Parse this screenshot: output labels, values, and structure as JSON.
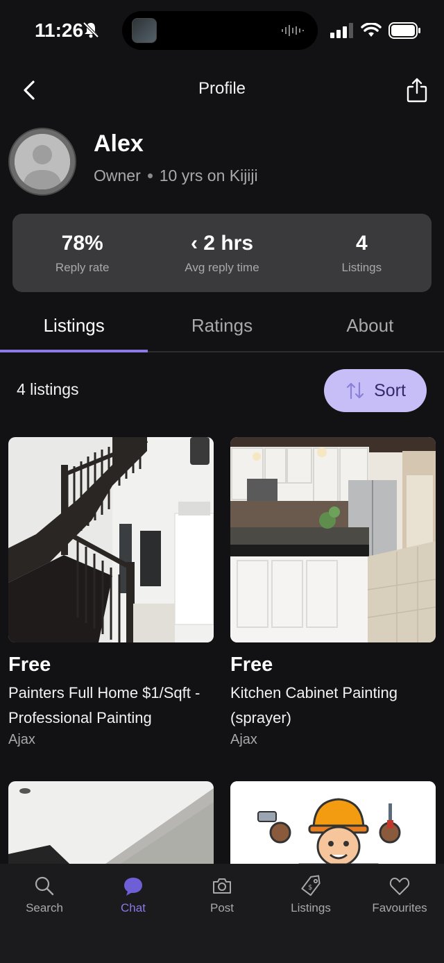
{
  "status": {
    "time": "11:26"
  },
  "nav": {
    "title": "Profile"
  },
  "profile": {
    "name": "Alex",
    "role": "Owner",
    "tenure": "10 yrs on Kijiji"
  },
  "stats": [
    {
      "value": "78%",
      "label": "Reply rate"
    },
    {
      "value": "‹ 2 hrs",
      "label": "Avg reply time"
    },
    {
      "value": "4",
      "label": "Listings"
    }
  ],
  "tabs": [
    {
      "label": "Listings",
      "active": true
    },
    {
      "label": "Ratings",
      "active": false
    },
    {
      "label": "About",
      "active": false
    }
  ],
  "listings_header": {
    "count": "4 listings",
    "sort_label": "Sort"
  },
  "listings": [
    {
      "price": "Free",
      "title": "Painters Full Home $1/Sqft - Professional Painting",
      "location": "Ajax",
      "image": "staircase-photo"
    },
    {
      "price": "Free",
      "title": "Kitchen Cabinet Painting (sprayer)",
      "location": "Ajax",
      "image": "kitchen-photo"
    },
    {
      "image": "ceiling-photo"
    },
    {
      "image": "painter-cartoon"
    }
  ],
  "bottom_nav": [
    {
      "label": "Search",
      "icon": "search-icon",
      "active": false
    },
    {
      "label": "Chat",
      "icon": "chat-icon",
      "active": true
    },
    {
      "label": "Post",
      "icon": "camera-icon",
      "active": false
    },
    {
      "label": "Listings",
      "icon": "tag-icon",
      "active": false
    },
    {
      "label": "Favourites",
      "icon": "heart-icon",
      "active": false
    }
  ],
  "colors": {
    "accent": "#8b79e6",
    "sort_bg": "#c7bef7",
    "background": "#121113",
    "stats_bg": "#3a3a3c"
  }
}
